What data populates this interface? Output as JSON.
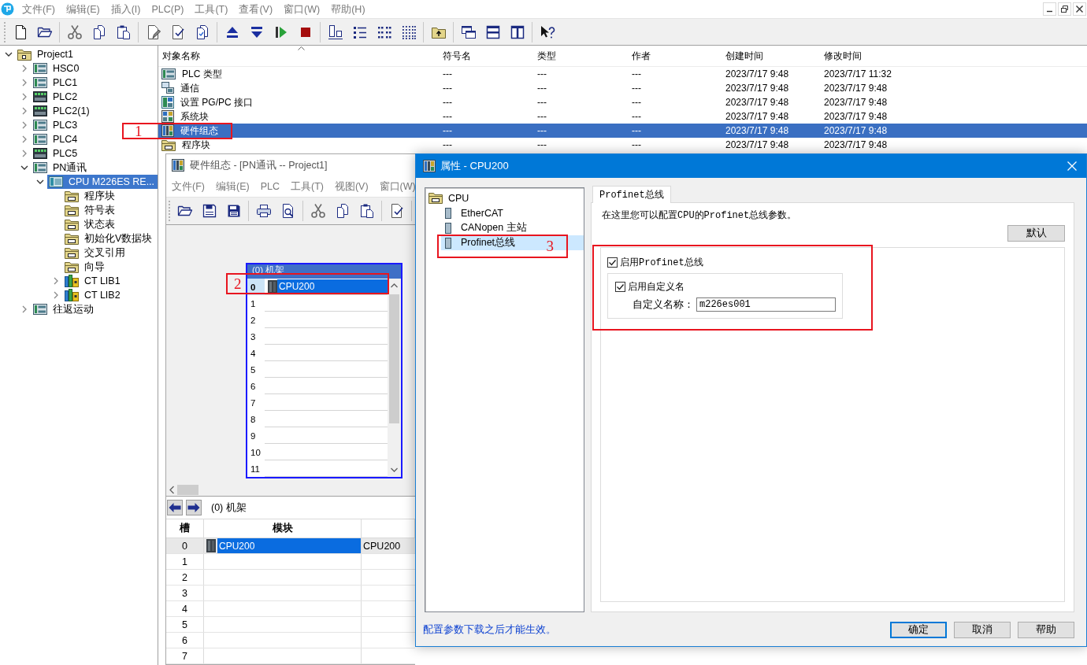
{
  "menu": [
    "文件(F)",
    "编辑(E)",
    "插入(I)",
    "PLC(P)",
    "工具(T)",
    "查看(V)",
    "窗口(W)",
    "帮助(H)"
  ],
  "project_tree": {
    "items": [
      {
        "label": "Project1",
        "kind": "project",
        "expandable": true,
        "expanded": true,
        "selected": false,
        "children": [
          {
            "label": "HSC0",
            "kind": "device",
            "expandable": true,
            "expanded": false,
            "selected": false
          },
          {
            "label": "PLC1",
            "kind": "device",
            "expandable": true,
            "expanded": false,
            "selected": false
          },
          {
            "label": "PLC2",
            "kind": "device_io",
            "expandable": true,
            "expanded": false,
            "selected": false
          },
          {
            "label": "PLC2(1)",
            "kind": "device_io",
            "expandable": true,
            "expanded": false,
            "selected": false
          },
          {
            "label": "PLC3",
            "kind": "device",
            "expandable": true,
            "expanded": false,
            "selected": false
          },
          {
            "label": "PLC4",
            "kind": "device",
            "expandable": true,
            "expanded": false,
            "selected": false
          },
          {
            "label": "PLC5",
            "kind": "device_io",
            "expandable": true,
            "expanded": false,
            "selected": false
          },
          {
            "label": "PN通讯",
            "kind": "device",
            "expandable": true,
            "expanded": true,
            "selected": false,
            "children": [
              {
                "label": "CPU M226ES RE...",
                "kind": "cpu",
                "expandable": true,
                "expanded": true,
                "selected": true,
                "children": [
                  {
                    "label": "程序块",
                    "kind": "folder",
                    "expandable": false,
                    "selected": false
                  },
                  {
                    "label": "符号表",
                    "kind": "folder",
                    "expandable": false,
                    "selected": false
                  },
                  {
                    "label": "状态表",
                    "kind": "folder",
                    "expandable": false,
                    "selected": false
                  },
                  {
                    "label": "初始化V数据块",
                    "kind": "folder",
                    "expandable": false,
                    "selected": false
                  },
                  {
                    "label": "交叉引用",
                    "kind": "folder",
                    "expandable": false,
                    "selected": false
                  },
                  {
                    "label": "向导",
                    "kind": "folder",
                    "expandable": false,
                    "selected": false
                  },
                  {
                    "label": "CT LIB1",
                    "kind": "library",
                    "expandable": true,
                    "expanded": false,
                    "selected": false
                  },
                  {
                    "label": "CT LIB2",
                    "kind": "library",
                    "expandable": true,
                    "expanded": false,
                    "selected": false
                  }
                ]
              }
            ]
          },
          {
            "label": "往返运动",
            "kind": "device",
            "expandable": true,
            "expanded": false,
            "selected": false
          }
        ]
      }
    ]
  },
  "object_list": {
    "columns": [
      {
        "label": "对象名称",
        "sorted": true
      },
      {
        "label": "符号名",
        "sorted": false
      },
      {
        "label": "类型",
        "sorted": false
      },
      {
        "label": "作者",
        "sorted": false
      },
      {
        "label": "创建时间",
        "sorted": false
      },
      {
        "label": "修改时间",
        "sorted": false
      }
    ],
    "rows": [
      {
        "kind": "device",
        "cells": [
          "PLC 类型",
          "---",
          "---",
          "---",
          "2023/7/17 9:48",
          "2023/7/17 11:32"
        ],
        "selected": false
      },
      {
        "kind": "network",
        "cells": [
          "通信",
          "---",
          "---",
          "---",
          "2023/7/17 9:48",
          "2023/7/17 9:48"
        ],
        "selected": false
      },
      {
        "kind": "interface",
        "cells": [
          "设置 PG/PC 接口",
          "---",
          "---",
          "---",
          "2023/7/17 9:48",
          "2023/7/17 9:48"
        ],
        "selected": false
      },
      {
        "kind": "grid",
        "cells": [
          "系统块",
          "---",
          "---",
          "---",
          "2023/7/17 9:48",
          "2023/7/17 9:48"
        ],
        "selected": false
      },
      {
        "kind": "hardware",
        "cells": [
          "硬件组态",
          "---",
          "---",
          "---",
          "2023/7/17 9:48",
          "2023/7/17 9:48"
        ],
        "selected": true
      },
      {
        "kind": "folder",
        "cells": [
          "程序块",
          "---",
          "---",
          "---",
          "2023/7/17 9:48",
          "2023/7/17 9:48"
        ],
        "selected": false
      }
    ]
  },
  "hardware_window": {
    "title": "硬件组态 - [PN通讯 -- Project1]",
    "menu": [
      "文件(F)",
      "编辑(E)",
      "PLC",
      "工具(T)",
      "视图(V)",
      "窗口(W)"
    ],
    "rack": {
      "title": "(0) 机架",
      "slots": [
        {
          "slot": "0",
          "module": "CPU200",
          "selected": true
        },
        {
          "slot": "1",
          "selected": false
        },
        {
          "slot": "2",
          "selected": false
        },
        {
          "slot": "3",
          "selected": false
        },
        {
          "slot": "4",
          "selected": false
        },
        {
          "slot": "5",
          "selected": false
        },
        {
          "slot": "6",
          "selected": false
        },
        {
          "slot": "7",
          "selected": false
        },
        {
          "slot": "8",
          "selected": false
        },
        {
          "slot": "9",
          "selected": false
        },
        {
          "slot": "10",
          "selected": false
        },
        {
          "slot": "11",
          "selected": false
        }
      ]
    },
    "module_table": {
      "title": "(0) 机架",
      "columns": [
        "槽",
        "模块"
      ],
      "rows": [
        {
          "slot": "0",
          "module": "CPU200",
          "column_3": "CPU200",
          "selected": true
        },
        {
          "slot": "1",
          "selected": false
        },
        {
          "slot": "2",
          "selected": false
        },
        {
          "slot": "3",
          "selected": false
        },
        {
          "slot": "4",
          "selected": false
        },
        {
          "slot": "5",
          "selected": false
        },
        {
          "slot": "6",
          "selected": false
        },
        {
          "slot": "7",
          "selected": false
        }
      ]
    }
  },
  "properties_dialog": {
    "title": "属性 - CPU200",
    "tree": [
      {
        "label": "CPU",
        "kind": "folder",
        "selected": false,
        "children": [
          {
            "label": "EtherCAT",
            "kind": "module",
            "selected": false
          },
          {
            "label": "CANopen 主站",
            "kind": "module",
            "selected": false
          },
          {
            "label": "Profinet总线",
            "kind": "module",
            "selected": true
          }
        ]
      }
    ],
    "tabs": [
      {
        "label": "Profinet总线",
        "selected": true
      }
    ],
    "description": "在这里您可以配置CPU的Profinet总线参数。",
    "default_button": "默认",
    "enable_profinet": {
      "label": "启用Profinet总线",
      "checked": true
    },
    "custom_name": {
      "enable": {
        "label": "启用自定义名",
        "checked": true
      },
      "name_label": "自定义名称：",
      "name_value": "m226es001"
    },
    "footer_note": "配置参数下载之后才能生效。",
    "buttons": [
      {
        "label": "确定",
        "default": true
      },
      {
        "label": "取消",
        "default": false
      },
      {
        "label": "帮助",
        "default": false
      }
    ]
  },
  "annotations": [
    {
      "kind": "numbered",
      "label": "1"
    },
    {
      "kind": "numbered",
      "label": "2"
    },
    {
      "kind": "numbered",
      "label": "3"
    },
    {
      "kind": "box"
    }
  ]
}
